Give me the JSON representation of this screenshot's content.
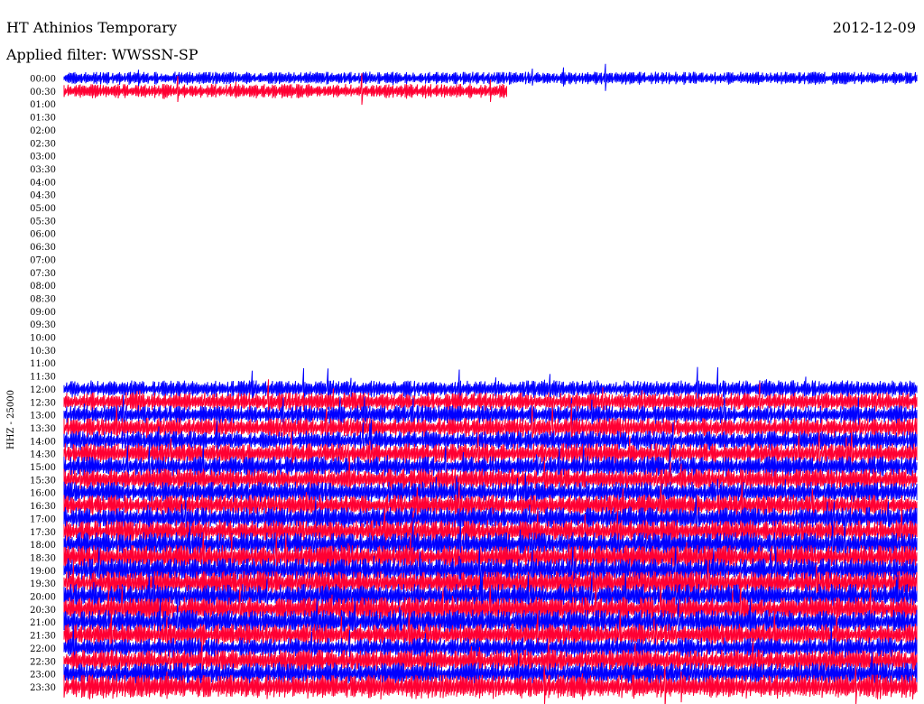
{
  "header": {
    "station": "HT Athinios Temporary",
    "date": "2012-12-09",
    "filter": "Applied filter: WWSSN-SP"
  },
  "chart_data": {
    "type": "line",
    "title": "HT Athinios Temporary",
    "subtitle": "Applied filter: WWSSN-SP",
    "date": "2012-12-09",
    "ylabel": "HHZ - 25000",
    "xlabel": "",
    "colors": [
      "#0000ff",
      "#ff0033"
    ],
    "grid": false,
    "legend": "none",
    "y_ticks": [
      "00:00",
      "00:30",
      "01:00",
      "01:30",
      "02:00",
      "02:30",
      "03:00",
      "03:30",
      "04:00",
      "04:30",
      "05:00",
      "05:30",
      "06:00",
      "06:30",
      "07:00",
      "07:30",
      "08:00",
      "08:30",
      "09:00",
      "09:30",
      "10:00",
      "10:30",
      "11:00",
      "11:30",
      "12:00",
      "12:30",
      "13:00",
      "13:30",
      "14:00",
      "14:30",
      "15:00",
      "15:30",
      "16:00",
      "16:30",
      "17:00",
      "17:30",
      "18:00",
      "18:30",
      "19:00",
      "19:30",
      "20:00",
      "20:30",
      "21:00",
      "21:30",
      "22:00",
      "22:30",
      "23:00",
      "23:30"
    ],
    "traces": [
      {
        "start": "00:00",
        "end_fraction": 1.0,
        "level": 0.35
      },
      {
        "start": "00:30",
        "end_fraction": 0.52,
        "level": 0.45
      },
      {
        "start": "12:00",
        "end_fraction": 1.0,
        "level": 0.6
      },
      {
        "start": "12:30",
        "end_fraction": 1.0,
        "level": 0.7
      },
      {
        "start": "13:00",
        "end_fraction": 1.0,
        "level": 0.7
      },
      {
        "start": "13:30",
        "end_fraction": 1.0,
        "level": 0.75
      },
      {
        "start": "14:00",
        "end_fraction": 1.0,
        "level": 0.75
      },
      {
        "start": "14:30",
        "end_fraction": 1.0,
        "level": 0.8
      },
      {
        "start": "15:00",
        "end_fraction": 1.0,
        "level": 0.8
      },
      {
        "start": "15:30",
        "end_fraction": 1.0,
        "level": 0.85
      },
      {
        "start": "16:00",
        "end_fraction": 1.0,
        "level": 0.85
      },
      {
        "start": "16:30",
        "end_fraction": 1.0,
        "level": 0.85
      },
      {
        "start": "17:00",
        "end_fraction": 1.0,
        "level": 0.9
      },
      {
        "start": "17:30",
        "end_fraction": 1.0,
        "level": 0.9
      },
      {
        "start": "18:00",
        "end_fraction": 1.0,
        "level": 1.0
      },
      {
        "start": "18:30",
        "end_fraction": 1.0,
        "level": 1.0
      },
      {
        "start": "19:00",
        "end_fraction": 1.0,
        "level": 1.0
      },
      {
        "start": "19:30",
        "end_fraction": 1.0,
        "level": 1.0
      },
      {
        "start": "20:00",
        "end_fraction": 1.0,
        "level": 1.0
      },
      {
        "start": "20:30",
        "end_fraction": 1.0,
        "level": 1.0
      },
      {
        "start": "21:00",
        "end_fraction": 1.0,
        "level": 1.0
      },
      {
        "start": "21:30",
        "end_fraction": 1.0,
        "level": 0.9
      },
      {
        "start": "22:00",
        "end_fraction": 1.0,
        "level": 0.8
      },
      {
        "start": "22:30",
        "end_fraction": 1.0,
        "level": 0.9
      },
      {
        "start": "23:00",
        "end_fraction": 1.0,
        "level": 0.9
      },
      {
        "start": "23:30",
        "end_fraction": 1.0,
        "level": 1.0
      }
    ]
  }
}
